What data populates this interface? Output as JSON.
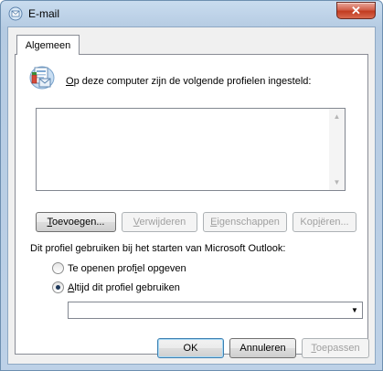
{
  "window": {
    "title": "E-mail",
    "close_glyph": "✕"
  },
  "tabs": [
    {
      "label": "Algemeen",
      "selected": true
    }
  ],
  "intro_text": {
    "accel": "O",
    "rest": "p deze computer zijn de volgende profielen ingesteld:"
  },
  "profile_list": {
    "items": [],
    "scroll_up_glyph": "▲",
    "scroll_down_glyph": "▼"
  },
  "profile_buttons": {
    "add": {
      "accel": "T",
      "rest": "oevoegen...",
      "enabled": true
    },
    "remove": {
      "pre": "",
      "accel": "V",
      "rest": "erwijderen",
      "enabled": false
    },
    "properties": {
      "accel": "E",
      "rest": "igenschappen",
      "enabled": false
    },
    "copy": {
      "pre": "Kop",
      "accel": "i",
      "rest": "ëren...",
      "enabled": false
    }
  },
  "startup_label": "Dit profiel gebruiken bij het starten van Microsoft Outlook:",
  "startup_options": {
    "prompt": {
      "pre": "Te openen prof",
      "accel": "i",
      "rest": "el opgeven",
      "checked": false
    },
    "always": {
      "pre": "",
      "accel": "A",
      "rest": "ltijd dit profiel gebruiken",
      "checked": true
    }
  },
  "profile_combo": {
    "selected_value": "",
    "arrow_glyph": "▼"
  },
  "dialog_buttons": {
    "ok": "OK",
    "cancel": "Annuleren",
    "apply": {
      "accel": "T",
      "rest": "oepassen",
      "enabled": false
    }
  },
  "icons": [
    "mail-profile-icon",
    "mail-window-icon",
    "close-icon",
    "chevron-down-icon"
  ],
  "colors": {
    "title_bar": "#bdd1e7",
    "close_button": "#c23b20",
    "default_button_border": "#3c7fb1"
  }
}
